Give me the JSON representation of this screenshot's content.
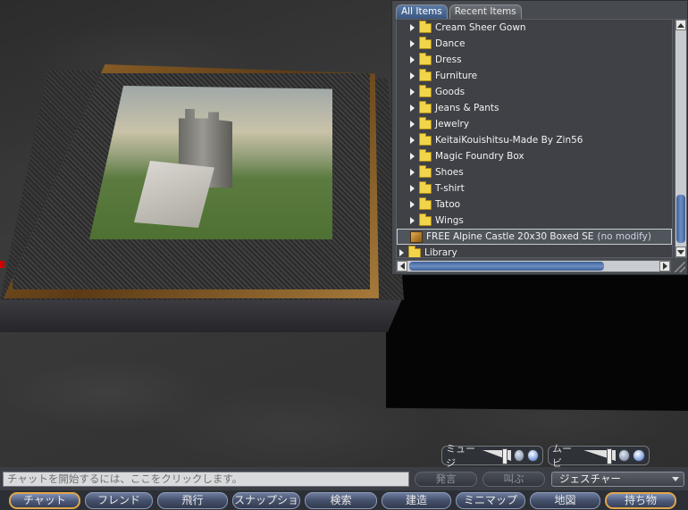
{
  "inventory": {
    "tabs": [
      "All Items",
      "Recent Items"
    ],
    "items": [
      {
        "label": "Cream Sheer Gown",
        "type": "folder"
      },
      {
        "label": "Dance",
        "type": "folder"
      },
      {
        "label": "Dress",
        "type": "folder"
      },
      {
        "label": "Furniture",
        "type": "folder"
      },
      {
        "label": "Goods",
        "type": "folder"
      },
      {
        "label": "Jeans & Pants",
        "type": "folder"
      },
      {
        "label": "Jewelry",
        "type": "folder"
      },
      {
        "label": "KeitaiKouishitsu-Made By Zin56",
        "type": "folder"
      },
      {
        "label": "Magic Foundry Box",
        "type": "folder"
      },
      {
        "label": "Shoes",
        "type": "folder"
      },
      {
        "label": "T-shirt",
        "type": "folder"
      },
      {
        "label": "Tatoo",
        "type": "folder"
      },
      {
        "label": "Wings",
        "type": "folder"
      },
      {
        "label": "FREE Alpine Castle 20x30 Boxed SE",
        "suffix": "(no modify)",
        "type": "object",
        "selected": true
      },
      {
        "label": "Library",
        "type": "root-folder"
      }
    ]
  },
  "media": {
    "music_label": "ミュージ",
    "movie_label": "ムービ"
  },
  "chat": {
    "placeholder": "チャットを開始するには、ここをクリックします。",
    "say_label": "発言",
    "shout_label": "叫ぶ",
    "gesture_label": "ジェスチャー"
  },
  "toolbar": {
    "buttons": [
      "チャット",
      "フレンド",
      "飛行",
      "スナップショ",
      "検索",
      "建造",
      "ミニマップ",
      "地図",
      "持ち物"
    ],
    "active": [
      "チャット",
      "持ち物"
    ]
  },
  "colors": {
    "selected_tab": "#3a5780",
    "scroll_thumb": "#4e72ab",
    "folder": "#f2d44a",
    "toolbar_button": "#44506b",
    "active_outline": "#e0a54a"
  }
}
